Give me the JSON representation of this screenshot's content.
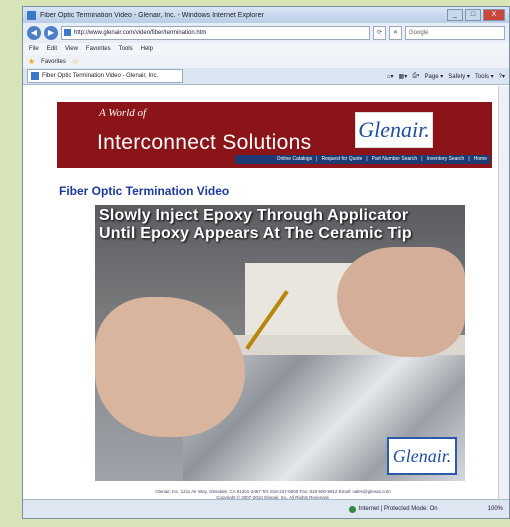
{
  "window": {
    "title": "Fiber Optic Termination Video - Glenair, Inc. - Windows Internet Explorer",
    "controls": [
      "_",
      "□",
      "X"
    ]
  },
  "address": {
    "url": "http://www.glenair.com/video/fiber/termination.htm",
    "search_placeholder": "Google"
  },
  "menu": [
    "File",
    "Edit",
    "View",
    "Favorites",
    "Tools",
    "Help"
  ],
  "favorites": {
    "label": "Favorites"
  },
  "tab": {
    "label": "Fiber Optic Termination Video - Glenair, Inc."
  },
  "commandbar": [
    "Page ▾",
    "Safety ▾",
    "Tools ▾"
  ],
  "banner": {
    "tagline_1": "A World of",
    "headline": "Interconnect Solutions",
    "logo": "Glenair.",
    "nav_links": [
      "Online Catalogs",
      "Request for Quote",
      "Part Number Search",
      "Inventory Search",
      "Home"
    ]
  },
  "page": {
    "heading": "Fiber Optic Termination Video"
  },
  "video": {
    "caption_line1": "Slowly Inject Epoxy Through Applicator",
    "caption_line2": "Until Epoxy Appears At The Ceramic Tip",
    "logo": "Glenair."
  },
  "footer": {
    "line1": "Glenair, Inc. 1211 Air Way, Glendale, CA 91201-2497 Tel: 818-247-6000 Fax: 818-500-9912 Email: sales@glenair.com",
    "line2": "Copyright © 2007-2010 Glenair, Inc. All Rights Reserved."
  },
  "status": {
    "zone": "Internet | Protected Mode: On",
    "zoom": "100%"
  }
}
